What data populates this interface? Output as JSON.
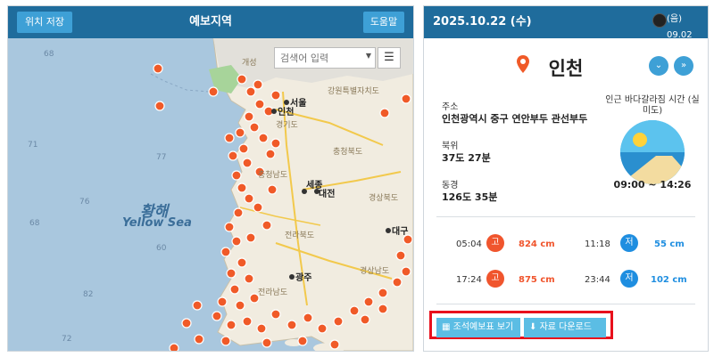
{
  "left": {
    "save_label": "위치 저장",
    "title": "예보지역",
    "help_label": "도움말",
    "search_placeholder": "검색어 입력",
    "sea_label_ko": "황해",
    "sea_label_en": "Yellow Sea",
    "cities": [
      "서울",
      "인천",
      "세종",
      "대전",
      "광주",
      "대구",
      "경기도",
      "충청북도",
      "충청남도",
      "전라북도",
      "전라남도",
      "경상북도",
      "경상남도",
      "강원특별자치도",
      "개성"
    ],
    "depths": [
      "68",
      "71",
      "77",
      "76",
      "68",
      "82",
      "60",
      "72"
    ]
  },
  "right": {
    "date": "2025.10.22 (수)",
    "moon_phase": "(음) 09.02",
    "location": "인천",
    "address_label": "주소",
    "address_value": "인천광역시 중구 연안부두 관선부두",
    "lat_label": "북위",
    "lat_value": "37도 27분",
    "lon_label": "동경",
    "lon_value": "126도 35분",
    "tide_title": "인근 바다갈라짐 시간 (실미도)",
    "tide_hours": "09:00 ~ 14:26",
    "tides": [
      {
        "time": "05:04",
        "type": "고",
        "level": "824 cm"
      },
      {
        "time": "11:18",
        "type": "저",
        "level": "55 cm"
      },
      {
        "time": "17:24",
        "type": "고",
        "level": "875 cm"
      },
      {
        "time": "23:44",
        "type": "저",
        "level": "102 cm"
      }
    ],
    "btn_table": "조석예보표 보기",
    "btn_download": "자료 다운로드"
  },
  "icons": [
    "map-marker-icon",
    "menu-icon",
    "chevron-down-icon",
    "double-chevron-down-icon",
    "moon-icon",
    "calendar-icon",
    "download-icon",
    "location-pin-icon"
  ],
  "colors": {
    "header": "#1f6c9c",
    "button": "#3ea0d6",
    "high_tide": "#f0552d",
    "low_tide": "#1f8ee0",
    "highlight": "#e8101c",
    "marker": "#f05a28"
  }
}
